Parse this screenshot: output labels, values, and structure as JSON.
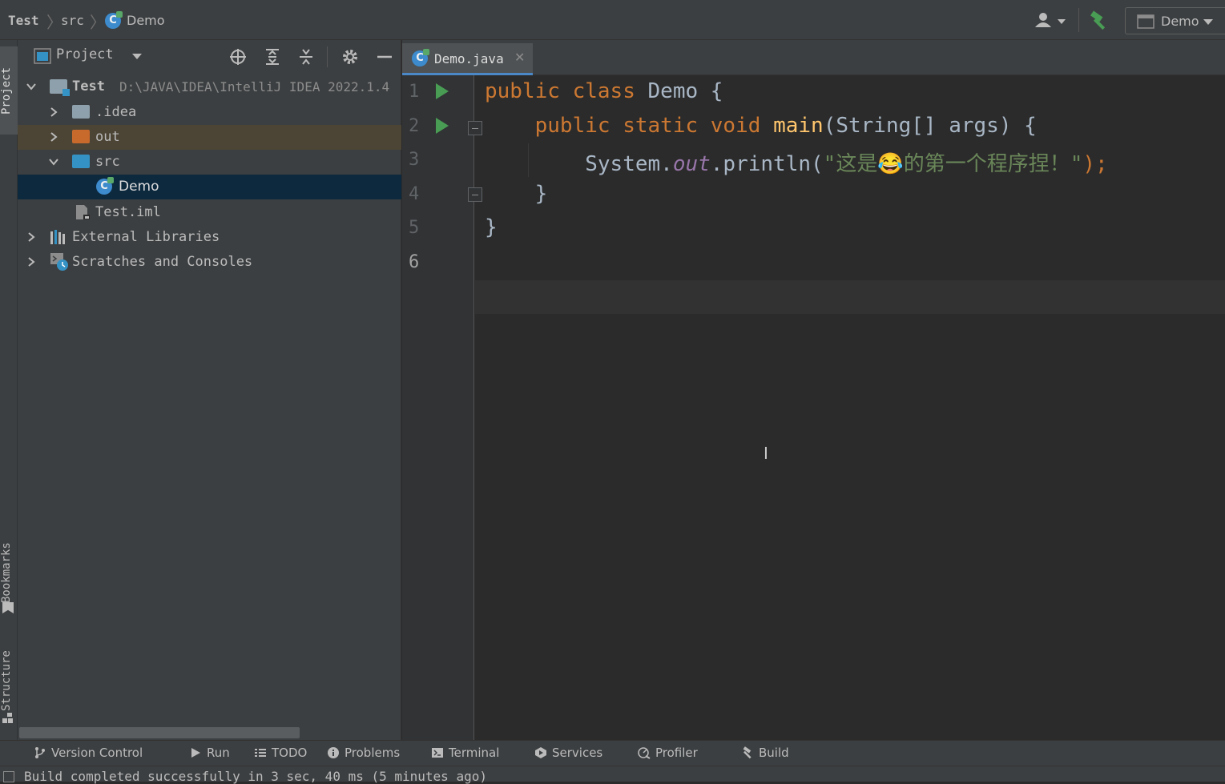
{
  "navbar": {
    "crumb_project": "Test",
    "crumb_src": "src",
    "crumb_file": "Demo",
    "run_config": "Demo"
  },
  "left_strip": {
    "project": "Project",
    "bookmarks": "Bookmarks",
    "structure": "Structure"
  },
  "project_panel": {
    "title": "Project",
    "tree": {
      "root_label": "Test",
      "root_path": "D:\\JAVA\\IDEA\\IntelliJ IDEA 2022.1.4",
      "idea": ".idea",
      "out": "out",
      "src": "src",
      "demo": "Demo",
      "iml": "Test.iml",
      "ext_libs": "External Libraries",
      "scratches": "Scratches and Consoles"
    }
  },
  "editor": {
    "tab_label": "Demo.java",
    "line_numbers": [
      "1",
      "2",
      "3",
      "4",
      "5",
      "6"
    ],
    "code": {
      "l1_kw1": "public",
      "l1_kw2": "class",
      "l1_name": "Demo",
      "l1_brace": "{",
      "l2_kw1": "public",
      "l2_kw2": "static",
      "l2_kw3": "void",
      "l2_fn": "main",
      "l2_params": "(String[] args) {",
      "l3_sys": "System.",
      "l3_out": "out",
      "l3_call": ".println(",
      "l3_str": "\"这是😂的第一个程序捏！\"",
      "l3_end": ");",
      "l4_brace": "}",
      "l5_brace": "}"
    }
  },
  "bottom_bar": {
    "version_control": "Version Control",
    "run": "Run",
    "todo": "TODO",
    "problems": "Problems",
    "terminal": "Terminal",
    "services": "Services",
    "profiler": "Profiler",
    "build": "Build"
  },
  "status": {
    "message": "Build completed successfully in 3 sec, 40 ms (5 minutes ago)"
  },
  "colors": {
    "keyword": "#cc7832",
    "function": "#ffc66d",
    "string": "#6a8759",
    "field": "#9876aa",
    "selection": "#0d293e",
    "accent": "#4a88c7"
  }
}
